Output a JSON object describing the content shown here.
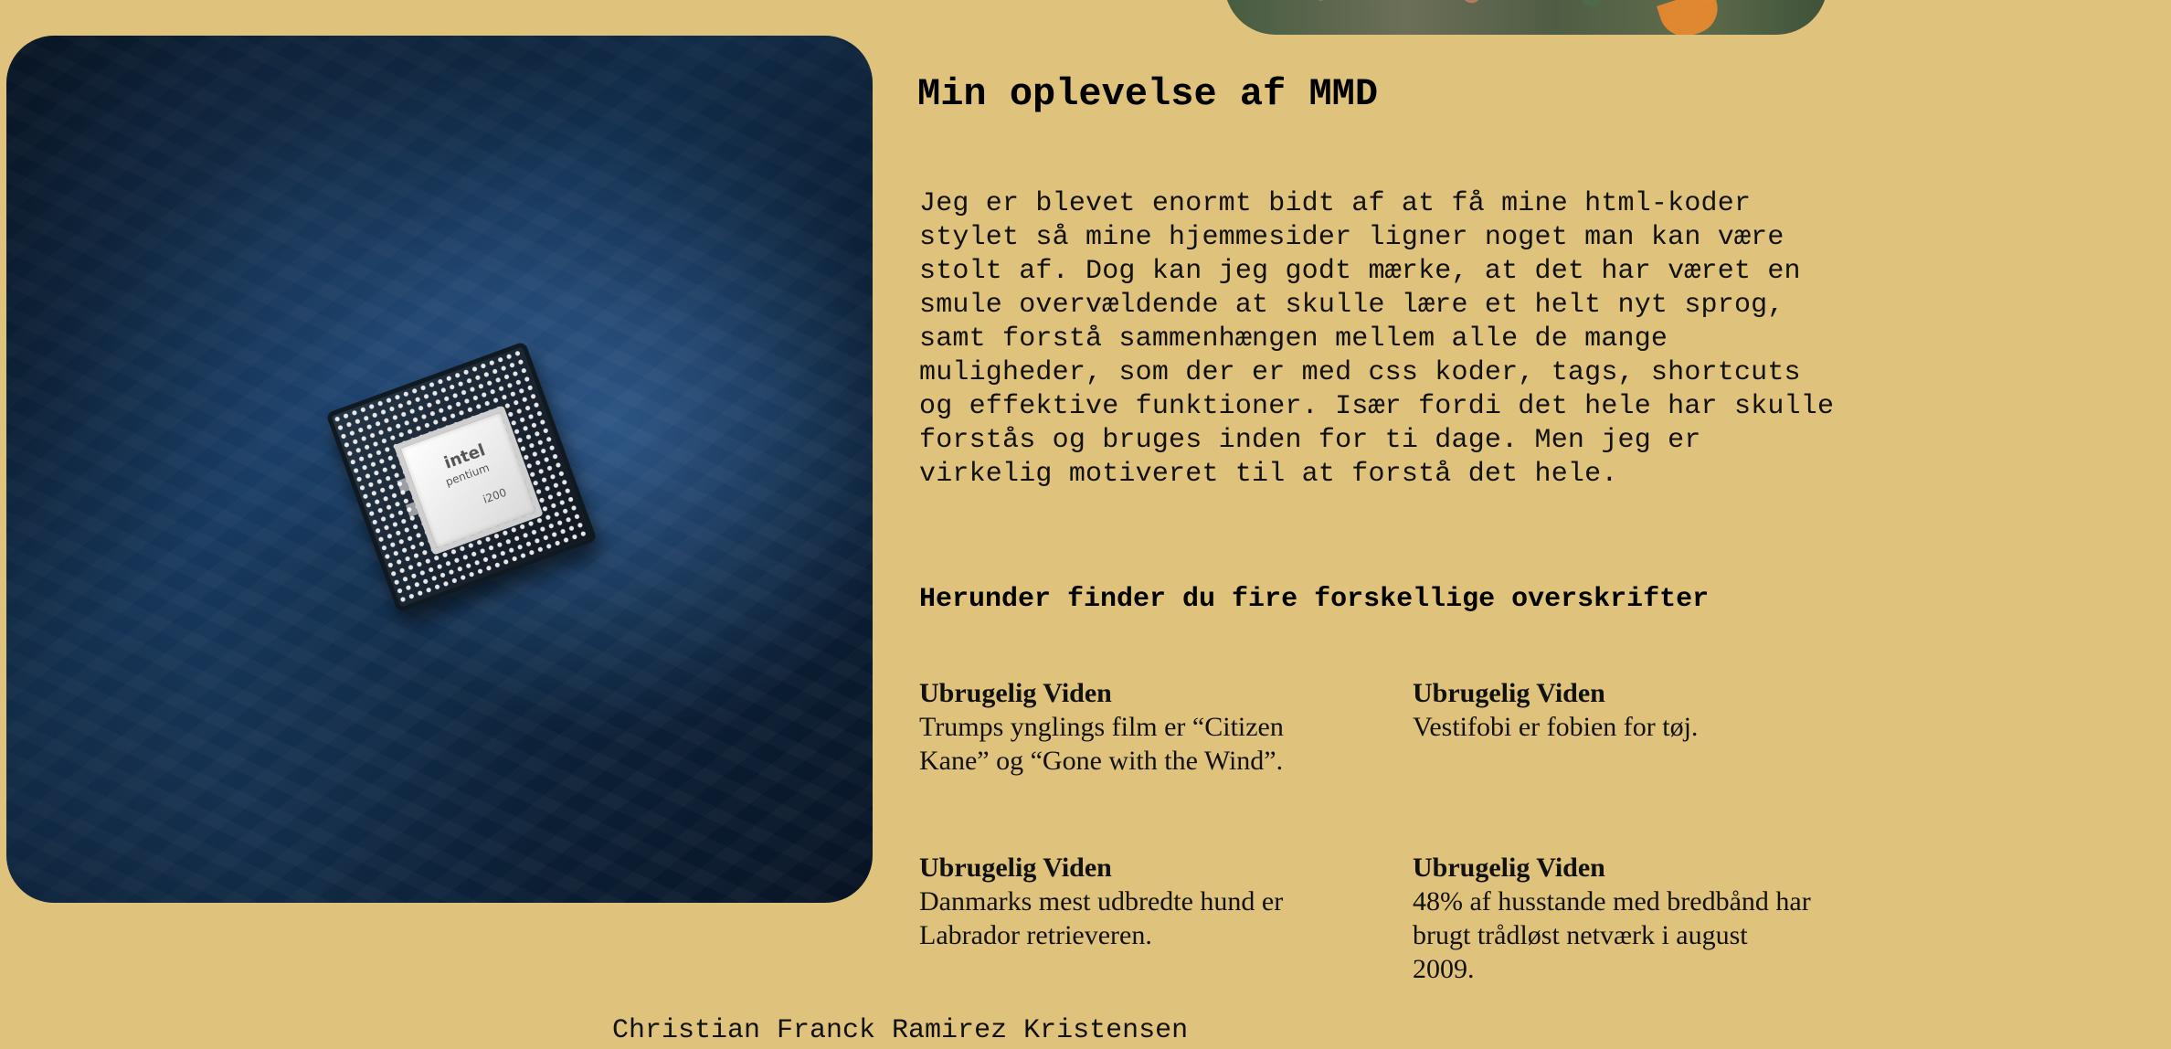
{
  "header": {
    "title": "Min oplevelse af MMD"
  },
  "article": {
    "intro": "Jeg er blevet enormt bidt af at få mine html-koder stylet så mine hjemmesider ligner noget man kan være stolt af. Dog kan jeg godt mærke, at det har været en smule overvældende at skulle lære et helt nyt sprog, samt forstå sammenhængen mellem alle de mange muligheder, som der er med css koder, tags, shortcuts og effektive funktioner. Især fordi det hele har skulle forstås og bruges inden for ti dage. Men jeg er virkelig motiveret til at forstå det hele.",
    "section_heading": "Herunder finder du fire forskellige overskrifter"
  },
  "facts": [
    {
      "title": "Ubrugelig Viden",
      "text": "Trumps ynglings film er “Citizen Kane” og “Gone with the Wind”."
    },
    {
      "title": "Ubrugelig Viden",
      "text": "Vestifobi er fobien for tøj."
    },
    {
      "title": "Ubrugelig Viden",
      "text": "Danmarks mest udbredte hund er Labrador retrieveren."
    },
    {
      "title": "Ubrugelig Viden",
      "text": "48% af husstande med bredbånd har brugt trådløst netværk i august 2009."
    }
  ],
  "footer": {
    "author": "Christian Franck Ramirez Kristensen"
  },
  "colors": {
    "background": "#dfc37c",
    "text": "#111111",
    "image_blue": "#173b63"
  }
}
